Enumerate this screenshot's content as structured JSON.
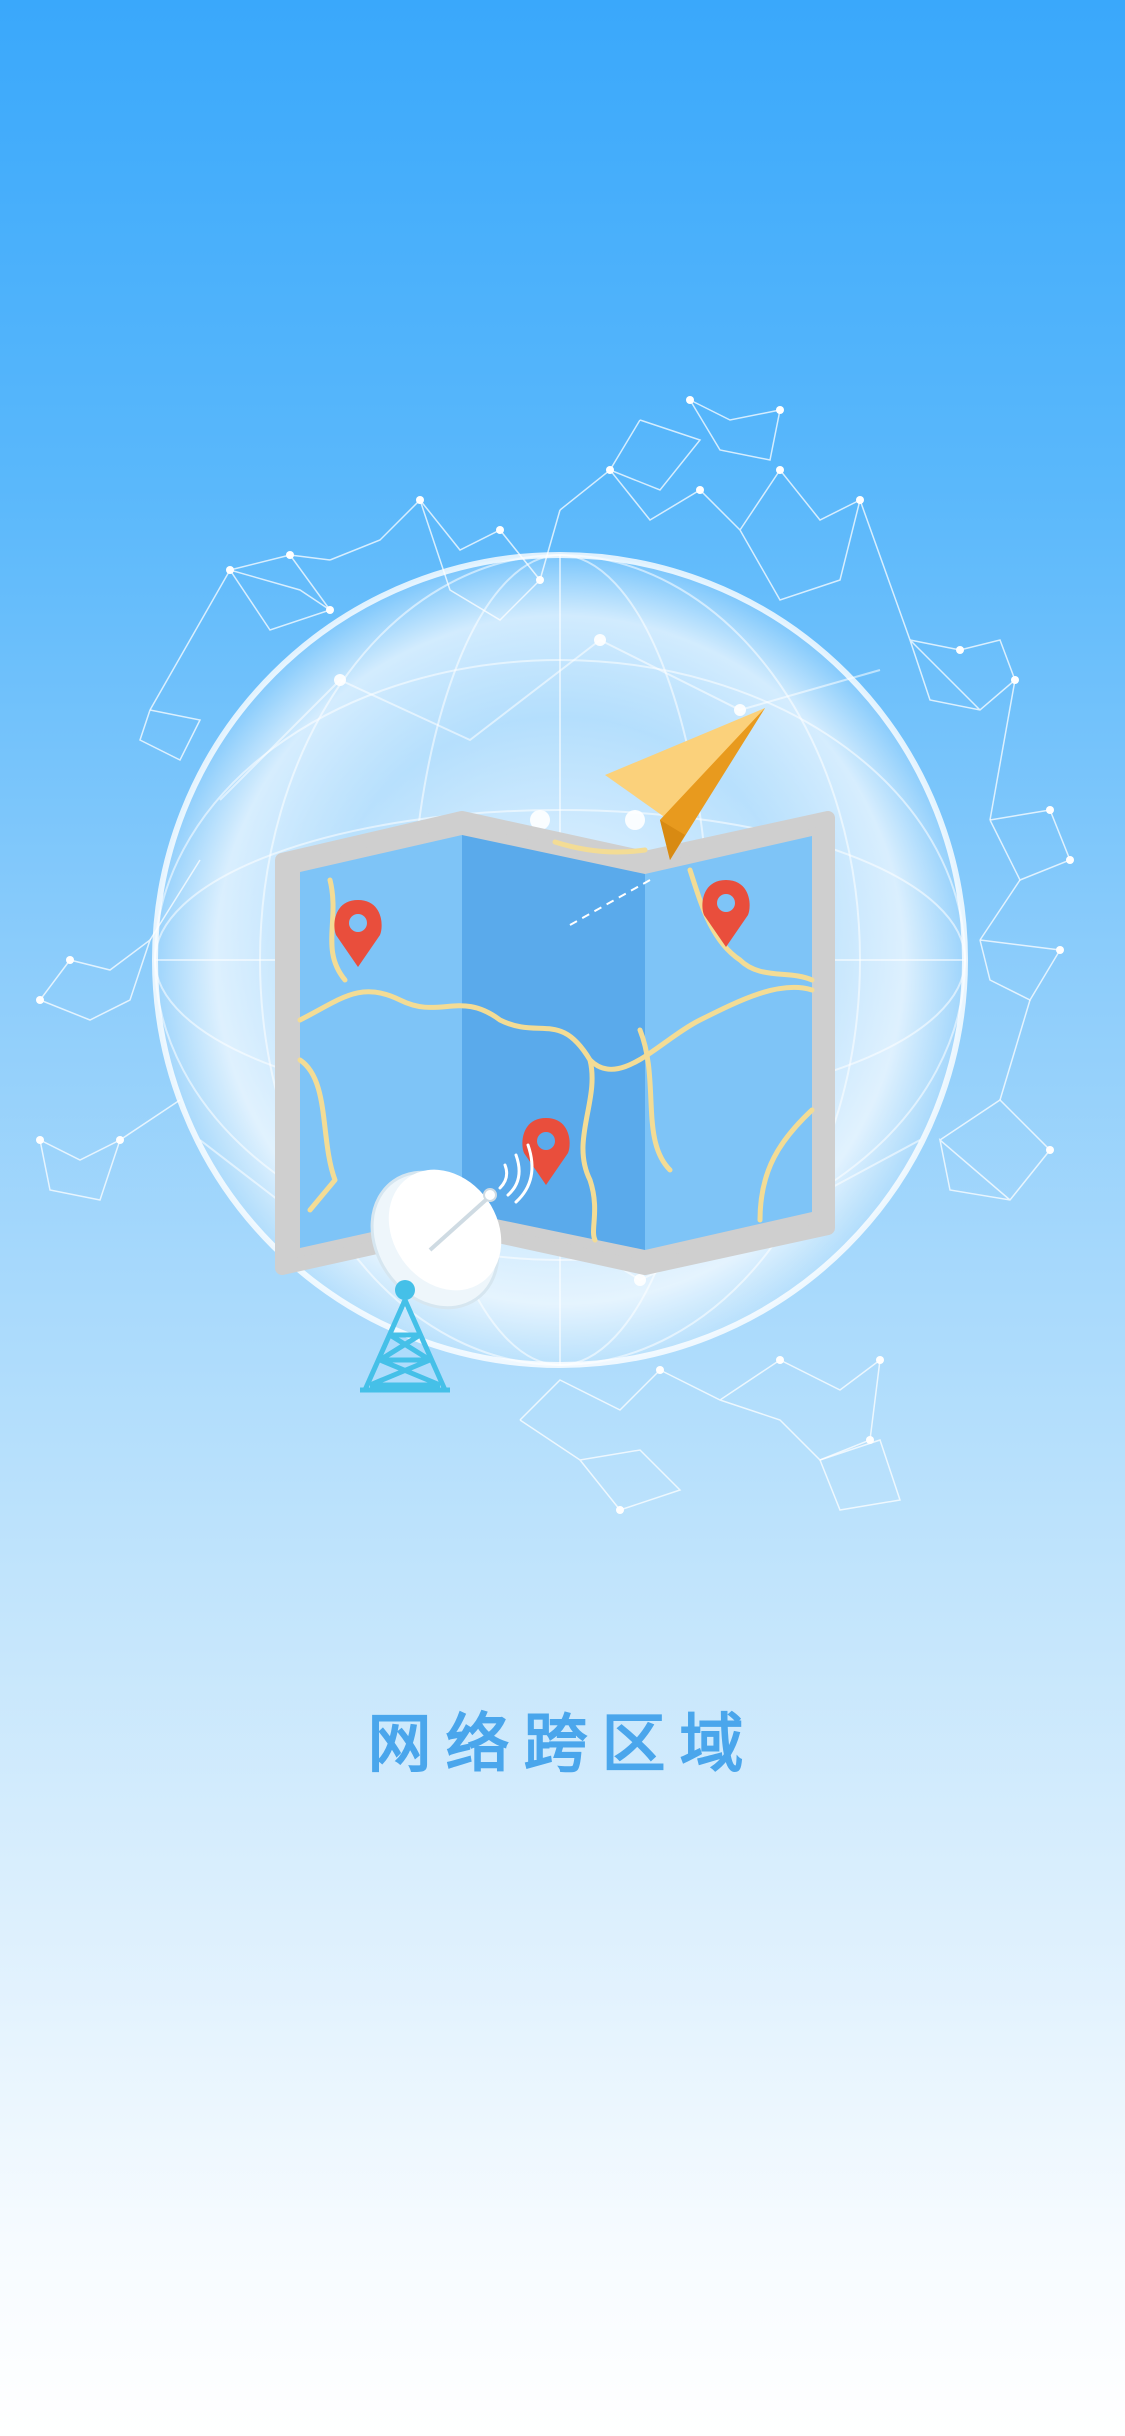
{
  "splash": {
    "title": "网络跨区域"
  },
  "illustration": {
    "icons": [
      "network-globe-icon",
      "folded-map-icon",
      "location-pin-icon",
      "paper-plane-icon",
      "satellite-dish-icon",
      "radio-tower-icon"
    ]
  },
  "colors": {
    "background_top": "#3aa8fb",
    "background_bottom": "#ffffff",
    "title": "#4aa6ec",
    "map_frame": "#cfcfcf",
    "map_left": "#7ec4f7",
    "map_middle": "#5aaaeb",
    "map_roads": "#f3dc95",
    "pin": "#e94e3c",
    "plane": "#f6b23c",
    "tower": "#45c0e8"
  }
}
